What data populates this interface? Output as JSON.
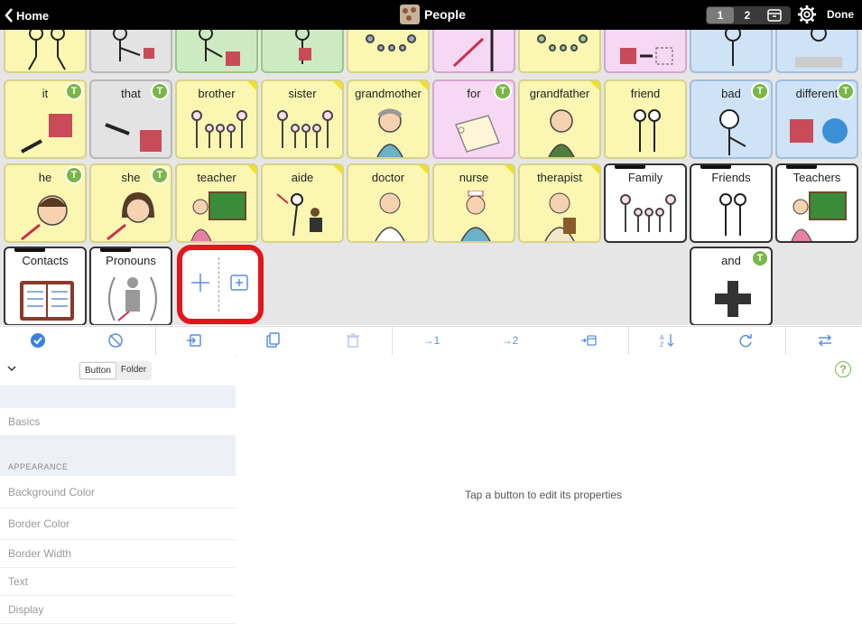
{
  "topbar": {
    "home_label": "Home",
    "title": "People",
    "pages": [
      "1",
      "2"
    ],
    "done_label": "Done"
  },
  "grid": {
    "row2": [
      "it",
      "that",
      "brother",
      "sister",
      "grandmother",
      "for",
      "grandfather",
      "friend",
      "bad",
      "different"
    ],
    "row3": [
      "he",
      "she",
      "teacher",
      "aide",
      "doctor",
      "nurse",
      "therapist",
      "Family",
      "Friends",
      "Teachers"
    ],
    "row4": [
      "Contacts",
      "Pronouns",
      "and"
    ],
    "badge_letter": "T"
  },
  "toolbar": {
    "move_to_1": "1",
    "move_to_2": "2"
  },
  "editor": {
    "seg_button": "Button",
    "seg_folder": "Folder",
    "rows": [
      "Basics",
      "Background Color",
      "Border Color",
      "Border Width",
      "Text",
      "Display"
    ],
    "section_appearance": "APPEARANCE",
    "hint": "Tap a button to edit its properties"
  },
  "colors": {
    "yellow": "#fbf7b2",
    "pink": "#f7d8f4",
    "blue": "#cfe3f7",
    "green": "#cdebc2",
    "badge_green": "#7ab648",
    "highlight_red": "#e3161b",
    "toolbar_blue": "#5a8fe0"
  }
}
